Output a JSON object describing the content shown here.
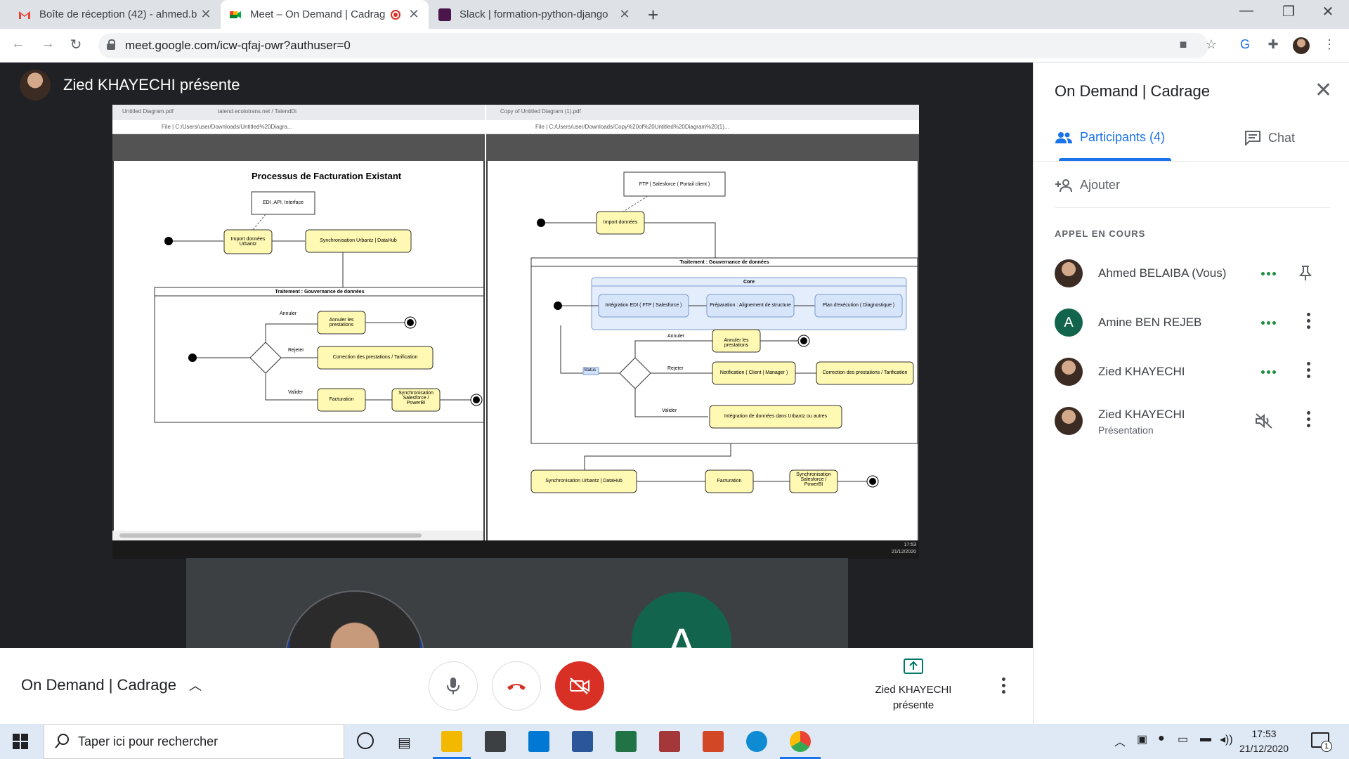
{
  "browser": {
    "tabs": [
      {
        "title": "Boîte de réception (42) - ahmed.b",
        "favicon": "gmail-icon",
        "color": "#ea4335"
      },
      {
        "title": "Meet – On Demand | Cadrag",
        "favicon": "meet-icon",
        "color": "#00832d"
      },
      {
        "title": "Slack | formation-python-django",
        "favicon": "slack-icon",
        "color": "#4a154b"
      }
    ],
    "url": "meet.google.com/icw-qfaj-owr?authuser=0"
  },
  "stage": {
    "presenter_label": "Zied KHAYECHI présente",
    "shared_left": {
      "tab1": "Untitled Diagram.pdf",
      "tab2": "talend.ecolotrans.net / TalendDi",
      "address": "File | C:/Users/user/Downloads/Untitled%20Diagra...",
      "diagram_title": "Processus de Facturation Existant",
      "note": "EDI ,API, Interface",
      "n_import": "Import données Urbantz",
      "n_sync": "Synchronisation Urbantz | DataHub",
      "swimlane": "Traitement : Gouvernance de données",
      "g_annuler": "Annuler",
      "g_rejeter": "Rejeter",
      "g_valider": "Valider",
      "n_annuler": "Annuler les prestations",
      "n_correction": "Correction des prestations / Tarification",
      "n_facturation": "Facturation",
      "n_sync_sf": "Synchronisation Salesforce / PowerBI"
    },
    "shared_right": {
      "tab1": "Copy of Untitled Diagram (1).pdf",
      "address": "File | C:/Users/user/Downloads/Copy%20of%20Untitled%20Diagram%20(1)...",
      "note": "FTP | Salesforce ( Portail client )",
      "n_import": "Import données",
      "swimlane": "Traitement : Gouvernance de données",
      "core": "Core",
      "n_integration": "Intégration EDI ( FTP | Salesforce )",
      "n_preparation": "Préparation : Alignement de structure",
      "n_plan": "Plan d'exécution ( Diagnostique )",
      "status": "Status",
      "g_annuler": "Annuler",
      "g_rejeter": "Rejeter",
      "g_valider": "Valider",
      "n_annuler": "Annuler les prestations",
      "n_notification": "Notification ( Client | Manager )",
      "n_correction": "Correction des prestations / Tarification",
      "n_integ_urbantz": "Intégration de données dans Urbantz ou autres",
      "n_sync": "Synchronisation Urbantz | DataHub",
      "n_facturation": "Facturation",
      "n_sync_sf": "Synchronisation Salesforce / PowerBI"
    },
    "shared_clock_time": "17:53",
    "shared_clock_date": "21/12/2020",
    "tile_letter": "A"
  },
  "controls": {
    "meeting_title": "On Demand | Cadrage",
    "present_line1": "Zied KHAYECHI",
    "present_line2": "présente"
  },
  "panel": {
    "title": "On Demand | Cadrage",
    "tab_participants": "Participants (4)",
    "tab_chat": "Chat",
    "add_label": "Ajouter",
    "section_label": "APPEL EN COURS",
    "participants": [
      {
        "name": "Ahmed BELAIBA (Vous)",
        "sub": ""
      },
      {
        "name": "Amine BEN REJEB",
        "sub": "",
        "initial": "A"
      },
      {
        "name": "Zied KHAYECHI",
        "sub": ""
      },
      {
        "name": "Zied KHAYECHI",
        "sub": "Présentation"
      }
    ]
  },
  "taskbar": {
    "search_placeholder": "Taper ici pour rechercher",
    "time": "17:53",
    "date": "21/12/2020",
    "notification_count": "1"
  }
}
